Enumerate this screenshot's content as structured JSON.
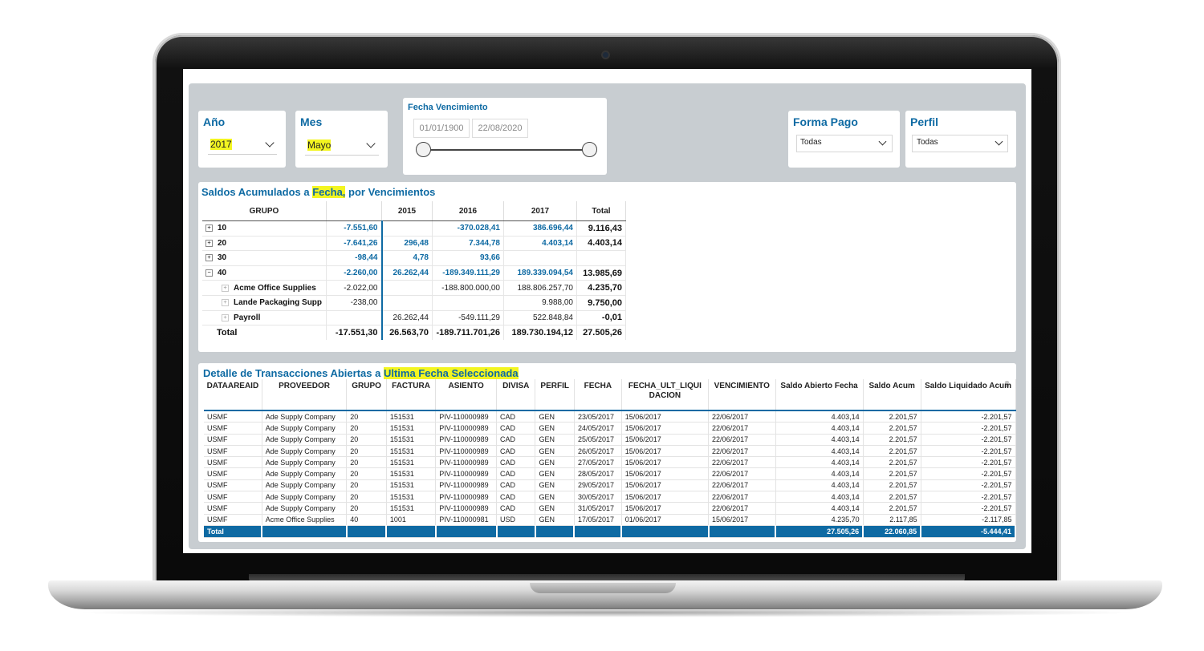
{
  "slicers": {
    "ano": {
      "title": "Año",
      "value": "2017"
    },
    "mes": {
      "title": "Mes",
      "value": "Mayo"
    },
    "fecha_vencimiento": {
      "title": "Fecha Vencimiento",
      "start": "01/01/1900",
      "end": "22/08/2020"
    },
    "forma_pago": {
      "title": "Forma Pago",
      "value": "Todas"
    },
    "perfil": {
      "title": "Perfil",
      "value": "Todas"
    }
  },
  "matrix": {
    "title_prefix": "Saldos Acumulados a ",
    "title_highlight": "Fecha,",
    "title_suffix": " por Vencimientos",
    "headers": [
      "GRUPO",
      "",
      "2015",
      "2016",
      "2017",
      "Total"
    ],
    "rows": [
      {
        "label": "10",
        "expander": "+",
        "c0": "-7.551,60",
        "c1": "",
        "c2": "-370.028,41",
        "c3": "386.696,44",
        "total": "9.116,43"
      },
      {
        "label": "20",
        "expander": "+",
        "c0": "-7.641,26",
        "c1": "296,48",
        "c2": "7.344,78",
        "c3": "4.403,14",
        "total": "4.403,14"
      },
      {
        "label": "30",
        "expander": "+",
        "c0": "-98,44",
        "c1": "4,78",
        "c2": "93,66",
        "c3": "",
        "total": ""
      },
      {
        "label": "40",
        "expander": "−",
        "c0": "-2.260,00",
        "c1": "26.262,44",
        "c2": "-189.349.111,29",
        "c3": "189.339.094,54",
        "total": "13.985,69"
      }
    ],
    "subrows": [
      {
        "label": "Acme Office Supplies",
        "expander": "+",
        "c0": "-2.022,00",
        "c1": "",
        "c2": "-188.800.000,00",
        "c3": "188.806.257,70",
        "total": "4.235,70"
      },
      {
        "label": "Lande Packaging Supp",
        "expander": "+",
        "c0": "-238,00",
        "c1": "",
        "c2": "",
        "c3": "9.988,00",
        "total": "9.750,00"
      },
      {
        "label": "Payroll",
        "expander": "+",
        "c0": "",
        "c1": "26.262,44",
        "c2": "-549.111,29",
        "c3": "522.848,84",
        "total": "-0,01"
      }
    ],
    "total": {
      "label": "Total",
      "c0": "-17.551,30",
      "c1": "26.563,70",
      "c2": "-189.711.701,26",
      "c3": "189.730.194,12",
      "total": "27.505,26"
    }
  },
  "detail": {
    "title_prefix": "Detalle de Transacciones Abiertas a ",
    "title_highlight": "Ultima Fecha Seleccionada",
    "headers": [
      "DATAAREAID",
      "PROVEEDOR",
      "GRUPO",
      "FACTURA",
      "ASIENTO",
      "DIVISA",
      "PERFIL",
      "FECHA",
      "FECHA_ULT_LIQUI DACION",
      "VENCIMIENTO",
      "Saldo Abierto Fecha",
      "Saldo Acum",
      "Saldo Liquidado Acum"
    ],
    "rows": [
      [
        "USMF",
        "Ade Supply Company",
        "20",
        "151531",
        "PIV-110000989",
        "CAD",
        "GEN",
        "23/05/2017",
        "15/06/2017",
        "22/06/2017",
        "4.403,14",
        "2.201,57",
        "-2.201,57"
      ],
      [
        "USMF",
        "Ade Supply Company",
        "20",
        "151531",
        "PIV-110000989",
        "CAD",
        "GEN",
        "24/05/2017",
        "15/06/2017",
        "22/06/2017",
        "4.403,14",
        "2.201,57",
        "-2.201,57"
      ],
      [
        "USMF",
        "Ade Supply Company",
        "20",
        "151531",
        "PIV-110000989",
        "CAD",
        "GEN",
        "25/05/2017",
        "15/06/2017",
        "22/06/2017",
        "4.403,14",
        "2.201,57",
        "-2.201,57"
      ],
      [
        "USMF",
        "Ade Supply Company",
        "20",
        "151531",
        "PIV-110000989",
        "CAD",
        "GEN",
        "26/05/2017",
        "15/06/2017",
        "22/06/2017",
        "4.403,14",
        "2.201,57",
        "-2.201,57"
      ],
      [
        "USMF",
        "Ade Supply Company",
        "20",
        "151531",
        "PIV-110000989",
        "CAD",
        "GEN",
        "27/05/2017",
        "15/06/2017",
        "22/06/2017",
        "4.403,14",
        "2.201,57",
        "-2.201,57"
      ],
      [
        "USMF",
        "Ade Supply Company",
        "20",
        "151531",
        "PIV-110000989",
        "CAD",
        "GEN",
        "28/05/2017",
        "15/06/2017",
        "22/06/2017",
        "4.403,14",
        "2.201,57",
        "-2.201,57"
      ],
      [
        "USMF",
        "Ade Supply Company",
        "20",
        "151531",
        "PIV-110000989",
        "CAD",
        "GEN",
        "29/05/2017",
        "15/06/2017",
        "22/06/2017",
        "4.403,14",
        "2.201,57",
        "-2.201,57"
      ],
      [
        "USMF",
        "Ade Supply Company",
        "20",
        "151531",
        "PIV-110000989",
        "CAD",
        "GEN",
        "30/05/2017",
        "15/06/2017",
        "22/06/2017",
        "4.403,14",
        "2.201,57",
        "-2.201,57"
      ],
      [
        "USMF",
        "Ade Supply Company",
        "20",
        "151531",
        "PIV-110000989",
        "CAD",
        "GEN",
        "31/05/2017",
        "15/06/2017",
        "22/06/2017",
        "4.403,14",
        "2.201,57",
        "-2.201,57"
      ],
      [
        "USMF",
        "Acme Office Supplies",
        "40",
        "1001",
        "PIV-110000981",
        "USD",
        "GEN",
        "17/05/2017",
        "01/06/2017",
        "15/06/2017",
        "4.235,70",
        "2.117,85",
        "-2.117,85"
      ]
    ],
    "total": {
      "label": "Total",
      "saldo_abierto": "27.505,26",
      "saldo_acum": "22.060,85",
      "saldo_liquidado": "-5.444,41"
    }
  },
  "colors": {
    "accent": "#0e6aa3",
    "highlight": "#f3f520",
    "canvas": "#c8cdd1"
  }
}
